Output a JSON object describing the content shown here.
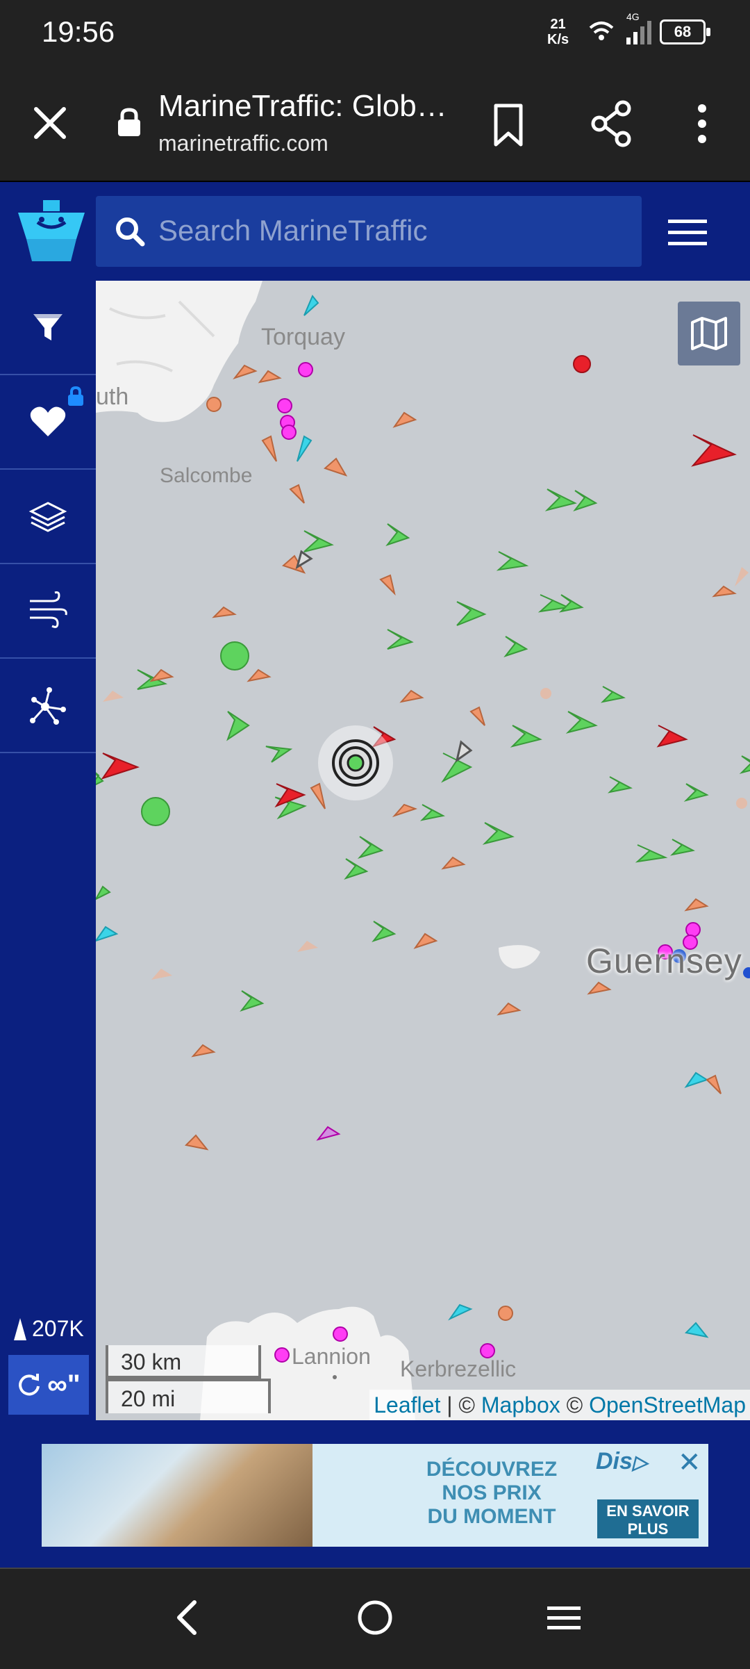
{
  "status": {
    "time": "19:56",
    "speed_value": "21",
    "speed_unit": "K/s",
    "network": "4G",
    "battery": "68"
  },
  "browser": {
    "title": "MarineTraffic: Glob…",
    "url": "marinetraffic.com"
  },
  "header": {
    "search_placeholder": "Search MarineTraffic"
  },
  "sidebar": {
    "items": [
      {
        "name": "filter",
        "icon": "funnel-icon"
      },
      {
        "name": "favorites",
        "icon": "heart-icon",
        "locked": true
      },
      {
        "name": "layers",
        "icon": "layers-icon"
      },
      {
        "name": "weather",
        "icon": "wind-icon"
      },
      {
        "name": "network",
        "icon": "network-icon"
      }
    ],
    "vessel_count": "207K",
    "replay_label": "∞\""
  },
  "map": {
    "places": [
      {
        "name": "Torquay"
      },
      {
        "name": "uth"
      },
      {
        "name": "Salcombe"
      },
      {
        "name": "Guernsey"
      },
      {
        "name": "Lannion"
      },
      {
        "name": "Kerbrezellic"
      }
    ],
    "scale_km": "30 km",
    "scale_mi": "20 mi",
    "attribution": {
      "leaflet": "Leaflet",
      "sep1": " | © ",
      "mapbox": "Mapbox",
      "sep2": " © ",
      "osm": "OpenStreetMap"
    }
  },
  "ad": {
    "line1": "DÉCOUVREZ",
    "line2": "NOS PRIX",
    "line3": "DU MOMENT",
    "brand": "Disney+",
    "cta_line1": "EN SAVOIR",
    "cta_line2": "PLUS"
  },
  "colors": {
    "navy": "#0b2080",
    "cargo_green": "#5ed35e",
    "tanker_red": "#e8202a",
    "passenger_blue": "#3bd4e8",
    "fishing_orange": "#f0956a",
    "pleasure_magenta": "#ff3df4",
    "sea": "#c8ccd1"
  }
}
